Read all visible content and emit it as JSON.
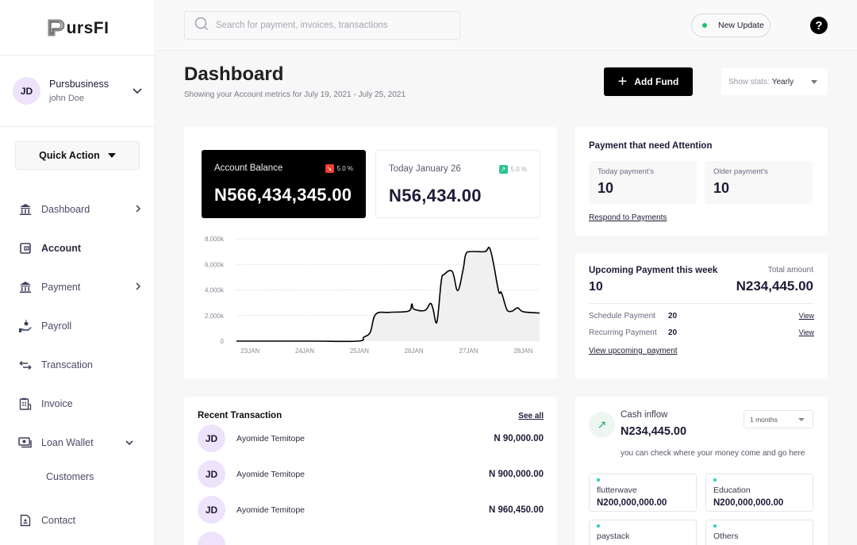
{
  "brand": {
    "name": "ursFI",
    "full_name": "PursFI"
  },
  "profile": {
    "initials": "JD",
    "business": "Pursbusiness",
    "user": "john Doe"
  },
  "quick_action": {
    "label": "Quick Action"
  },
  "sidebar": {
    "items": [
      {
        "label": "Dashboard",
        "icon": "bank-icon",
        "arrow": "›"
      },
      {
        "label": "Account",
        "icon": "wallet-icon"
      },
      {
        "label": "Payment",
        "icon": "bank-icon",
        "arrow": "›"
      },
      {
        "label": "Payroll",
        "icon": "hand-coin-icon"
      },
      {
        "label": "Transcation",
        "icon": "transfer-arrows-icon"
      },
      {
        "label": "Invoice",
        "icon": "invoice-icon"
      },
      {
        "label": "Loan Wallet",
        "icon": "cash-icon",
        "arrow": "⌄"
      },
      {
        "label": "Customers"
      },
      {
        "label": "Contact",
        "icon": "contact-icon"
      }
    ]
  },
  "header": {
    "search_placeholder": "Search for payment, invoices, transactions",
    "update_label": "New Update",
    "help_glyph": "?"
  },
  "page": {
    "title": "Dashboard",
    "subtitle": "Showing your Account metrics for July 19, 2021 - July 25, 2021",
    "add_fund_label": "Add Fund",
    "add_fund_glyph": "+",
    "stats_label": "Show stats:",
    "stats_value": "Yearly"
  },
  "balance": {
    "account": {
      "label": "Account Balance",
      "amount": "N566,434,345.00",
      "change": "5.0 %",
      "direction": "down",
      "color": "#ef4030"
    },
    "today": {
      "label": "Today January 26",
      "amount": "N56,434.00",
      "change": "5.0 %",
      "direction": "up",
      "color": "#2ec28f"
    }
  },
  "chart_data": {
    "type": "area",
    "title": "",
    "xlabel": "",
    "ylabel": "",
    "x_ticks": [
      "23JAN",
      "24JAN",
      "25JAN",
      "26JAN",
      "27JAN",
      "28JAN"
    ],
    "y_ticks": [
      "0",
      "2,000k",
      "4,000k",
      "6,000k",
      "8,000k"
    ],
    "ylim": [
      0,
      8000
    ],
    "xlim": [
      22.75,
      28.3
    ],
    "grid": true,
    "x": [
      22.75,
      23.5,
      24.2,
      24.98,
      25.08,
      25.2,
      25.3,
      25.55,
      25.9,
      25.96,
      26.0,
      26.2,
      26.3,
      26.35,
      26.42,
      26.5,
      26.55,
      26.7,
      26.8,
      26.9,
      26.95,
      27.05,
      27.3,
      27.38,
      27.45,
      27.55,
      27.6,
      27.68,
      27.72,
      27.8,
      27.9,
      28.0,
      28.3
    ],
    "y": [
      0,
      0,
      0,
      0,
      300,
      700,
      2100,
      2250,
      2350,
      2900,
      2500,
      2400,
      2950,
      2500,
      1500,
      4700,
      5200,
      5450,
      3950,
      5600,
      6800,
      7000,
      7000,
      7300,
      6200,
      3900,
      3800,
      2700,
      2350,
      2350,
      2600,
      2300,
      2200
    ]
  },
  "attention": {
    "title": "Payment that need Attention",
    "today_label": "Today payment's",
    "today_value": "10",
    "older_label": "Older payment's",
    "older_value": "10",
    "link": "Respond to Payments"
  },
  "upcoming": {
    "title": "Upcoming Payment this week",
    "count": "10",
    "total_label": "Total amount",
    "total": "N234,445.00",
    "rows": [
      {
        "label": "Schedule Payment",
        "value": "20",
        "link": "View"
      },
      {
        "label": "Recurring Payment",
        "value": "20",
        "link": "View"
      }
    ],
    "link": "View upcoming  payment"
  },
  "recent": {
    "title": "Recent Transaction",
    "see_all": "See all",
    "items": [
      {
        "initials": "JD",
        "name": "Ayomide Temitope",
        "amount": "N 90,000.00"
      },
      {
        "initials": "JD",
        "name": "Ayomide Temitope",
        "amount": "N 900,000.00"
      },
      {
        "initials": "JD",
        "name": "Ayomide Temitope",
        "amount": "N 960,450.00"
      }
    ]
  },
  "cash_inflow": {
    "label": "Cash inflow",
    "amount": "N234,445.00",
    "period": "1 months",
    "note": "you can check where your money come and go here",
    "sources": [
      {
        "name": "flutterwave",
        "value": "N200,000,000.00"
      },
      {
        "name": "Education",
        "value": "N200,000,000.00"
      },
      {
        "name": "paystack",
        "value": ""
      },
      {
        "name": "Others",
        "value": ""
      }
    ]
  }
}
